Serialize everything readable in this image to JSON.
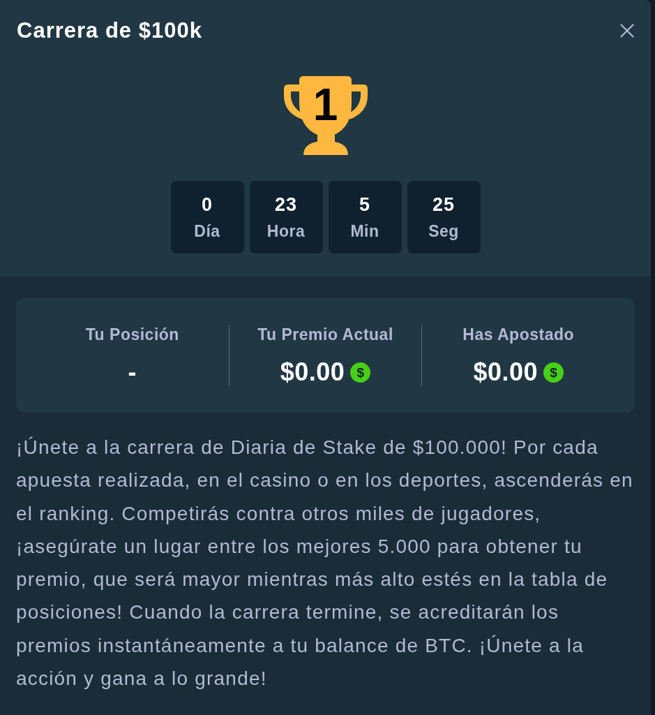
{
  "dialog": {
    "title": "Carrera de $100k"
  },
  "trophy": {
    "rank": "1"
  },
  "countdown": [
    {
      "value": "0",
      "unit": "Día"
    },
    {
      "value": "23",
      "unit": "Hora"
    },
    {
      "value": "5",
      "unit": "Min"
    },
    {
      "value": "25",
      "unit": "Seg"
    }
  ],
  "stats": [
    {
      "label": "Tu Posición",
      "value": "-"
    },
    {
      "label": "Tu Premio Actual",
      "value": "$0.00",
      "coin": "$"
    },
    {
      "label": "Has Apostado",
      "value": "$0.00",
      "coin": "$"
    }
  ],
  "description": "¡Únete a la carrera de Diaria de Stake de $100.000! Por cada apuesta realizada, en el casino o en los deportes, ascenderás en el ranking. Competirás contra otros miles de jugadores, ¡asegúrate un lugar entre los mejores 5.000 para obtener tu premio, que será mayor mientras más alto estés en la tabla de posiciones! Cuando la carrera termine, se acreditarán los premios instantáneamente a tu balance de BTC. ¡Únete a la acción y gana a lo grande!"
}
